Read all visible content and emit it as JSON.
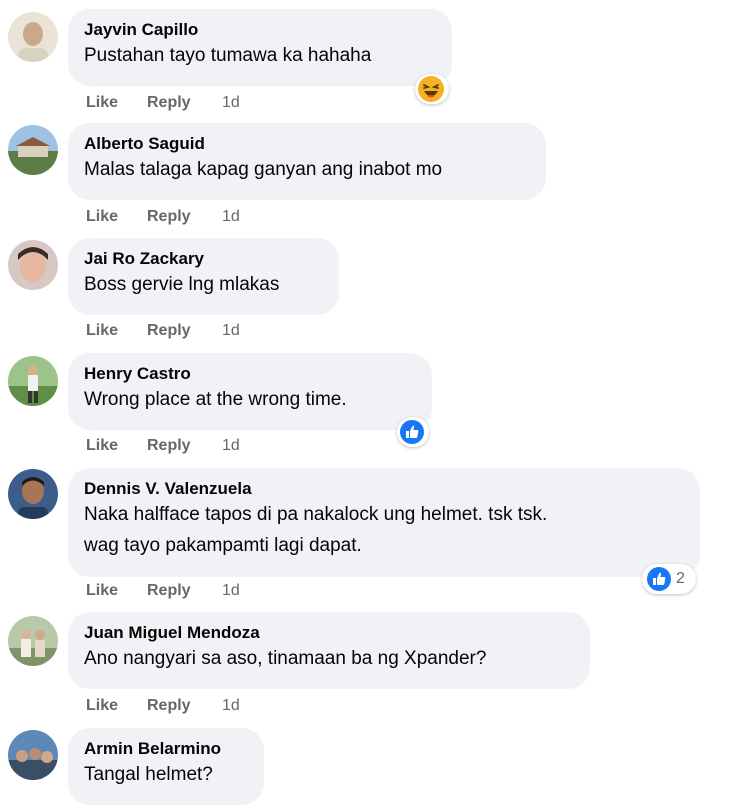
{
  "comments": [
    {
      "author": "Jayvin Capillo",
      "text": "Pustahan tayo tumawa ka hahaha",
      "like": "Like",
      "reply": "Reply",
      "time": "1d",
      "reaction": "haha-icon",
      "reaction_count": ""
    },
    {
      "author": "Alberto Saguid",
      "text": "Malas talaga kapag ganyan ang inabot mo",
      "like": "Like",
      "reply": "Reply",
      "time": "1d",
      "reaction": "",
      "reaction_count": ""
    },
    {
      "author": "Jai Ro Zackary",
      "text": "Boss gervie lng mlakas",
      "like": "Like",
      "reply": "Reply",
      "time": "1d",
      "reaction": "",
      "reaction_count": ""
    },
    {
      "author": "Henry Castro",
      "text": "Wrong place at the wrong time.",
      "like": "Like",
      "reply": "Reply",
      "time": "1d",
      "reaction": "like-icon",
      "reaction_count": ""
    },
    {
      "author": "Dennis V. Valenzuela",
      "text": "Naka halfface tapos di pa nakalock ung helmet. tsk tsk.\nwag tayo pakampamti lagi dapat.",
      "like": "Like",
      "reply": "Reply",
      "time": "1d",
      "reaction": "like-icon",
      "reaction_count": "2"
    },
    {
      "author": "Juan Miguel Mendoza",
      "text": "Ano nangyari sa aso, tinamaan ba ng Xpander?",
      "like": "Like",
      "reply": "Reply",
      "time": "1d",
      "reaction": "",
      "reaction_count": ""
    },
    {
      "author": "Armin Belarmino",
      "text": "Tangal helmet?",
      "like": "",
      "reply": "",
      "time": "",
      "reaction": "",
      "reaction_count": ""
    }
  ],
  "colors": {
    "bubble": "#f0f2f5",
    "action_text": "#65676b",
    "like_blue": "#1877f2",
    "haha_yellow": "#f7b125"
  }
}
